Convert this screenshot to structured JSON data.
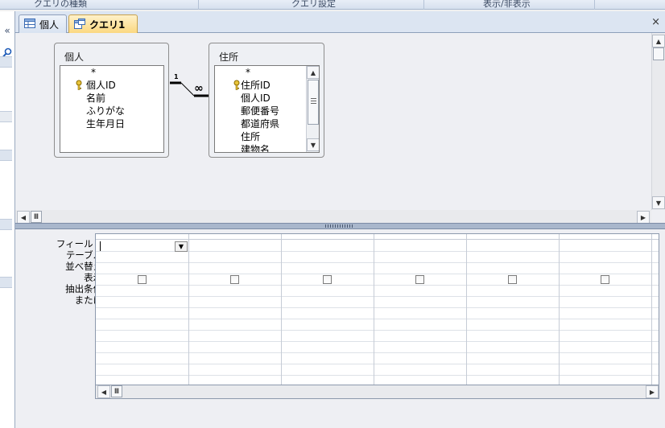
{
  "ribbon": {
    "groups": [
      "クエリの種類",
      "クエリ設定",
      "表示/非表示"
    ]
  },
  "nav": {
    "collapse": "«"
  },
  "tabs": [
    {
      "label": "個人",
      "icon": "table-icon",
      "active": false
    },
    {
      "label": "クエリ1",
      "icon": "query-icon",
      "active": true
    }
  ],
  "close_symbol": "×",
  "tables": [
    {
      "name": "個人",
      "fields": [
        {
          "name": "*",
          "key": false
        },
        {
          "name": "個人ID",
          "key": true
        },
        {
          "name": "名前",
          "key": false
        },
        {
          "name": "ふりがな",
          "key": false
        },
        {
          "name": "生年月日",
          "key": false
        }
      ]
    },
    {
      "name": "住所",
      "fields": [
        {
          "name": "*",
          "key": false
        },
        {
          "name": "住所ID",
          "key": true
        },
        {
          "name": "個人ID",
          "key": false
        },
        {
          "name": "郵便番号",
          "key": false
        },
        {
          "name": "都道府県",
          "key": false
        },
        {
          "name": "住所",
          "key": false
        },
        {
          "name": "建物名",
          "key": false
        }
      ]
    }
  ],
  "relationship": {
    "one_label": "1",
    "many_label": "∞"
  },
  "grid": {
    "row_labels": [
      "フィールド:",
      "テーブル:",
      "並べ替え:",
      "表示:",
      "抽出条件:",
      "または:"
    ],
    "field_value": "",
    "columns": 6,
    "show_checked": [
      false,
      false,
      false,
      false,
      false,
      false
    ]
  },
  "scroll": {
    "grip": "Ⅲ"
  }
}
